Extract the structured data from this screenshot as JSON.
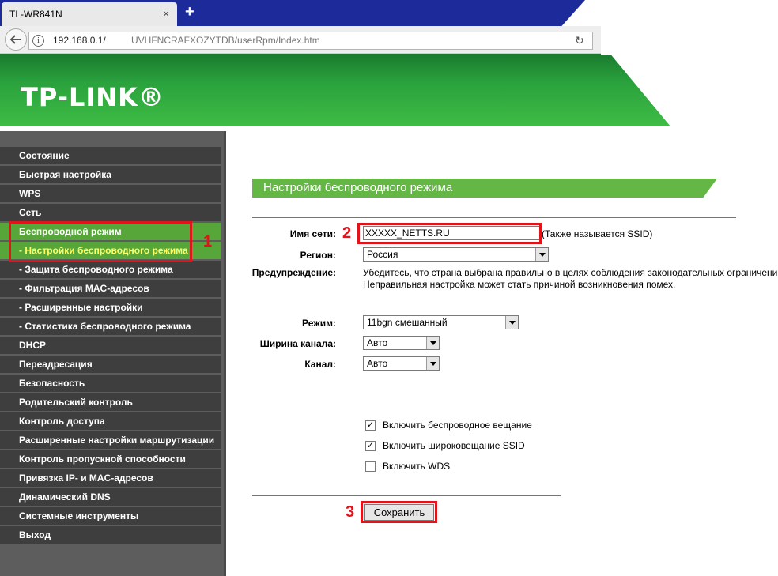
{
  "browser": {
    "tab_title": "TL-WR841N",
    "tab_close": "×",
    "new_tab": "+",
    "url_host": "192.168.0.1/",
    "url_path": "UVHFNCRAFXOZYTDB/userRpm/Index.htm",
    "info": "i"
  },
  "header": {
    "logo": "TP-LINK®"
  },
  "sidebar": {
    "items": [
      {
        "label": "Состояние"
      },
      {
        "label": "Быстрая настройка"
      },
      {
        "label": "WPS"
      },
      {
        "label": "Сеть"
      },
      {
        "label": "Беспроводной режим"
      },
      {
        "label": "- Настройки беспроводного режима"
      },
      {
        "label": "- Защита беспроводного режима"
      },
      {
        "label": "- Фильтрация MAC-адресов"
      },
      {
        "label": "- Расширенные настройки"
      },
      {
        "label": "- Статистика беспроводного режима"
      },
      {
        "label": "DHCP"
      },
      {
        "label": "Переадресация"
      },
      {
        "label": "Безопасность"
      },
      {
        "label": "Родительский контроль"
      },
      {
        "label": "Контроль доступа"
      },
      {
        "label": "Расширенные настройки маршрутизации"
      },
      {
        "label": "Контроль пропускной способности"
      },
      {
        "label": "Привязка IP- и MAC-адресов"
      },
      {
        "label": "Динамический DNS"
      },
      {
        "label": "Системные инструменты"
      },
      {
        "label": "Выход"
      }
    ]
  },
  "main": {
    "title": "Настройки беспроводного режима",
    "ssid_label": "Имя сети:",
    "ssid_value": "XXXXX_NETTS.RU",
    "ssid_hint": "(Также называется SSID)",
    "region_label": "Регион:",
    "region_value": "Россия",
    "warning_label": "Предупреждение:",
    "warning_line1": "Убедитесь, что страна выбрана правильно в целях соблюдения законодательных ограничений.",
    "warning_line2": "Неправильная настройка может стать причиной возникновения помех.",
    "mode_label": "Режим:",
    "mode_value": "11bgn смешанный",
    "width_label": "Ширина канала:",
    "width_value": "Авто",
    "channel_label": "Канал:",
    "channel_value": "Авто",
    "cb_radio": "Включить беспроводное вещание",
    "cb_ssid": "Включить широковещание SSID",
    "cb_wds": "Включить WDS",
    "check_mark": "✓",
    "save_label": "Сохранить"
  },
  "annotations": {
    "n1": "1",
    "n2": "2",
    "n3": "3"
  },
  "colors": {
    "accent_green": "#64b645",
    "annotation_red": "#e0141b",
    "sidebar_dark": "#3e3e3e"
  }
}
